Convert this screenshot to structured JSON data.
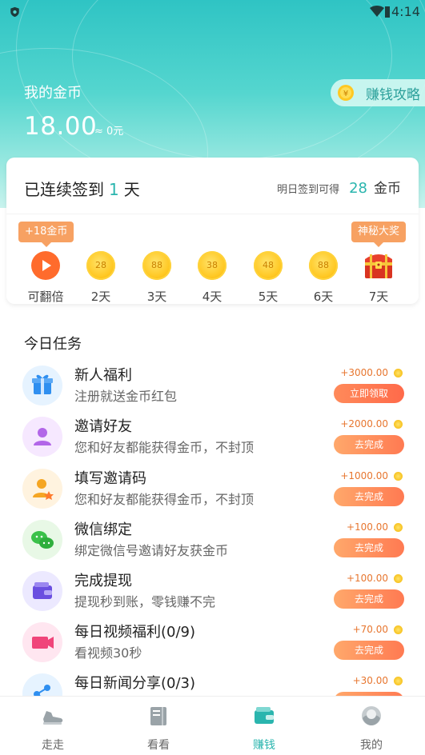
{
  "status_bar": {
    "time": "4:14"
  },
  "header": {
    "coin_label": "我的金币",
    "coin_value": "18.00",
    "approx": "≈ 0元",
    "strategy_label": "赚钱攻略"
  },
  "signin": {
    "title_prefix": "已连续签到",
    "streak": "1",
    "title_suffix": "天",
    "tip_prefix": "明日签到可得",
    "tip_amount": "28",
    "tip_unit": "金币",
    "badge_first": "+18金币",
    "badge_last": "神秘大奖",
    "days": [
      {
        "label": "可翻倍",
        "coin": "",
        "icon": "play-icon"
      },
      {
        "label": "2天",
        "coin": "28",
        "icon": "coin-icon"
      },
      {
        "label": "3天",
        "coin": "88",
        "icon": "coin-icon"
      },
      {
        "label": "4天",
        "coin": "38",
        "icon": "coin-icon"
      },
      {
        "label": "5天",
        "coin": "48",
        "icon": "coin-icon"
      },
      {
        "label": "6天",
        "coin": "88",
        "icon": "coin-icon"
      },
      {
        "label": "7天",
        "coin": "",
        "icon": "treasure-chest-icon"
      }
    ]
  },
  "tasks": {
    "title": "今日任务",
    "items": [
      {
        "title": "新人福利",
        "desc": "注册就送金币红包",
        "reward": "+3000.00",
        "button": "立即领取",
        "icon": "gift-icon",
        "color": "#e6f3ff"
      },
      {
        "title": "邀请好友",
        "desc": "您和好友都能获得金币，不封顶",
        "reward": "+2000.00",
        "button": "去完成",
        "icon": "user-icon",
        "color": "#f6e8ff"
      },
      {
        "title": "填写邀请码",
        "desc": "您和好友都能获得金币，不封顶",
        "reward": "+1000.00",
        "button": "去完成",
        "icon": "user-star-icon",
        "color": "#fff3df"
      },
      {
        "title": "微信绑定",
        "desc": "绑定微信号邀请好友获金币",
        "reward": "+100.00",
        "button": "去完成",
        "icon": "wechat-icon",
        "color": "#e8f8e6"
      },
      {
        "title": "完成提现",
        "desc": "提现秒到账，零钱赚不完",
        "reward": "+100.00",
        "button": "去完成",
        "icon": "wallet-icon",
        "color": "#ece9ff"
      },
      {
        "title": "每日视频福利(0/9)",
        "desc": "看视频30秒",
        "reward": "+70.00",
        "button": "去完成",
        "icon": "video-icon",
        "color": "#ffe6f0"
      },
      {
        "title": "每日新闻分享(0/3)",
        "desc": "",
        "reward": "+30.00",
        "button": "",
        "icon": "share-icon",
        "color": "#e6f3ff"
      }
    ]
  },
  "nav": {
    "items": [
      {
        "label": "走走",
        "icon": "shoe-icon"
      },
      {
        "label": "看看",
        "icon": "book-icon"
      },
      {
        "label": "赚钱",
        "icon": "wallet-icon",
        "active": true
      },
      {
        "label": "我的",
        "icon": "avatar-icon"
      }
    ]
  }
}
